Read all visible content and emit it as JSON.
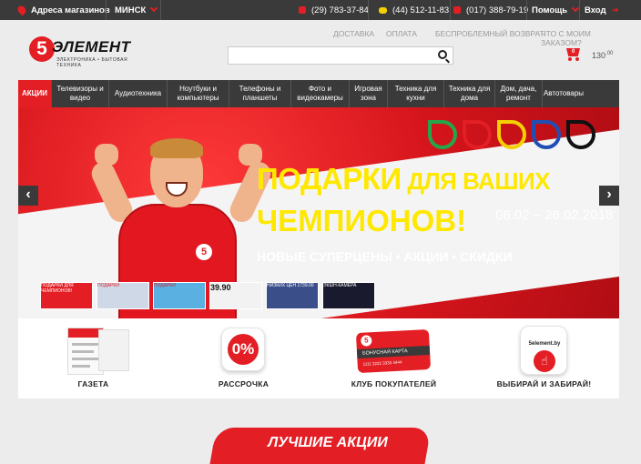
{
  "topbar": {
    "stores_label": "Адреса магазинов",
    "city": "МИНСК",
    "phones": [
      "(29) 783-37-84",
      "(44) 512-11-83",
      "(017) 388-79-19"
    ],
    "help": "Помощь",
    "login": "Вход"
  },
  "header": {
    "logo_digit": "5",
    "logo_word": "ЭЛЕМЕНТ",
    "logo_sub": "ЭЛЕКТРОНИКА • БЫТОВАЯ ТЕХНИКА",
    "links": [
      "ДОСТАВКА",
      "ОПЛАТА",
      "БЕСПРОБЛЕМНЫЙ ВОЗВРАТ",
      "ЧТО С МОИМ ЗАКАЗОМ?"
    ],
    "search_placeholder": "",
    "cart_count": "0",
    "cart_total": "130",
    "cart_total_kop": ".00"
  },
  "nav": {
    "items": [
      "АКЦИИ",
      "Телевизоры и видео",
      "Аудиотехника",
      "Ноутбуки и компьютеры",
      "Телефоны и планшеты",
      "Фото и видеокамеры",
      "Игровая зона",
      "Техника для кухни",
      "Техника для дома",
      "Дом, дача, ремонт",
      "Автотовары"
    ]
  },
  "banner": {
    "title_line1_big": "ПОДАРКИ",
    "title_line1_small": " ДЛЯ ВАШИХ",
    "title_line2": "ЧЕМПИОНОВ!",
    "dates": "06.02 – 26.02.2018",
    "subtitle": "НОВЫЕ СУПЕРЦЕНЫ • АКЦИИ • СКИДКИ",
    "prev": "‹",
    "next": "›",
    "thumbs": [
      "ПОДАРКИ ДЛЯ ЧЕМПИОНОВ!",
      "ПОДАРКИ",
      "ПОДАРКИ",
      "39.90",
      "НИЗКИХ ЦЕН 1739.00",
      "ЭКШН-КАМЕРА"
    ],
    "drop_colors": [
      "#26a64a",
      "#e31e24",
      "#f5d000",
      "#1f4fb4",
      "#111111"
    ]
  },
  "tiles": [
    {
      "label": "ГАЗЕТА"
    },
    {
      "label": "РАССРОЧКА",
      "badge": "0%"
    },
    {
      "label": "КЛУБ ПОКУПАТЕЛЕЙ",
      "card_text": "БОНУСНАЯ КАРТА",
      "card_num": "1111 2222 3333 4444"
    },
    {
      "label": "ВЫБИРАЙ И ЗАБИРАЙ!",
      "site": "5element.by"
    }
  ],
  "bottom_heading": "ЛУЧШИЕ АКЦИИ",
  "colors": {
    "brand": "#e31e24",
    "dark": "#3a3a3a",
    "promo_yellow": "#ffe800"
  }
}
